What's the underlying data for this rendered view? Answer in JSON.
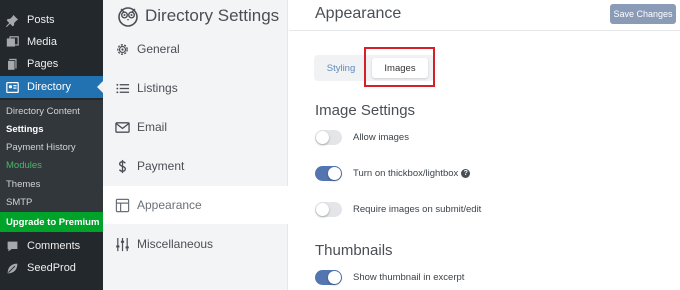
{
  "wp_menu": {
    "items": [
      {
        "label": "Posts",
        "icon": "pin-icon"
      },
      {
        "label": "Media",
        "icon": "media-icon"
      },
      {
        "label": "Pages",
        "icon": "pages-icon"
      },
      {
        "label": "Directory",
        "icon": "directory-icon"
      }
    ],
    "submenu": [
      "Directory Content",
      "Settings",
      "Payment History",
      "Modules",
      "Themes",
      "SMTP"
    ],
    "upgrade_label": "Upgrade to Premium",
    "bottom_items": [
      {
        "label": "Comments",
        "icon": "comment-icon"
      },
      {
        "label": "SeedProd",
        "icon": "leaf-icon"
      }
    ]
  },
  "directory_sidebar": {
    "title": "Directory Settings",
    "items": [
      {
        "label": "General",
        "icon": "gear-icon"
      },
      {
        "label": "Listings",
        "icon": "list-icon"
      },
      {
        "label": "Email",
        "icon": "envelope-icon"
      },
      {
        "label": "Payment",
        "icon": "dollar-icon"
      },
      {
        "label": "Appearance",
        "icon": "layout-icon"
      },
      {
        "label": "Miscellaneous",
        "icon": "sliders-icon"
      }
    ]
  },
  "main": {
    "title": "Appearance",
    "save_label": "Save Changes",
    "tabs": [
      "Styling",
      "Images"
    ],
    "image_settings_title": "Image Settings",
    "image_options": [
      {
        "label": "Allow images",
        "enabled": false
      },
      {
        "label": "Turn on thickbox/lightbox",
        "enabled": true,
        "help": "?"
      },
      {
        "label": "Require images on submit/edit",
        "enabled": false
      }
    ],
    "thumbnails_title": "Thumbnails",
    "thumbnail_options": [
      {
        "label": "Show thumbnail in excerpt",
        "enabled": true
      }
    ]
  },
  "colors": {
    "wp_sidebar": "#23282d",
    "wp_active": "#2271b1",
    "upgrade_green": "#00a32a",
    "toggle_on": "#5376b0",
    "save_button": "#8a9bb8",
    "highlight_box": "#d61f26"
  }
}
